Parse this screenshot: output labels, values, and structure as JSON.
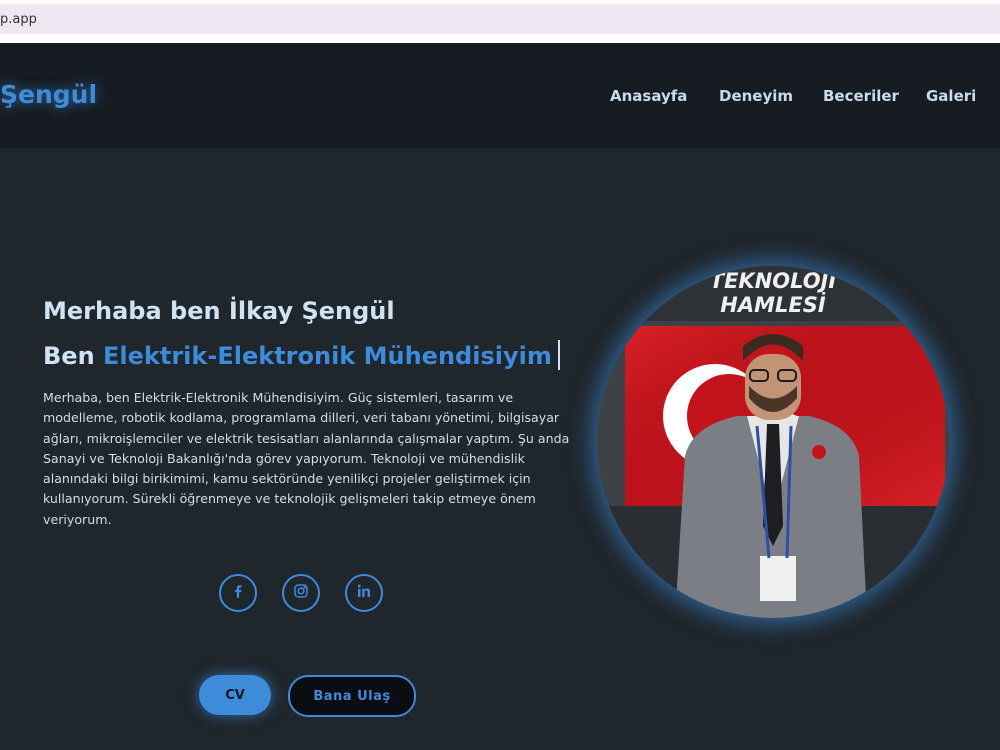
{
  "browser": {
    "url_text": "p.app"
  },
  "header": {
    "logo": "Şengül",
    "nav": [
      "Anasayfa",
      "Deneyim",
      "Beceriler",
      "Galeri"
    ]
  },
  "hero": {
    "greeting": "Merhaba ben İlkay Şengül",
    "role_prefix": "Ben",
    "role_highlight": "Elektrik-Elektronik Mühendisiyim",
    "description": "Merhaba, ben Elektrik-Elektronik Mühendisiyim. Güç sistemleri, tasarım ve modelleme, robotik kodlama, programlama dilleri, veri tabanı yönetimi, bilgisayar ağları, mikroişlemciler ve elektrik tesisatları alanlarında çalışmalar yaptım. Şu anda Sanayi ve Teknoloji Bakanlığı'nda görev yapıyorum. Teknoloji ve mühendislik alanındaki bilgi birikimimi, kamu sektöründe yenilikçi projeler geliştirmek için kullanıyorum. Sürekli öğrenmeye ve teknolojik gelişmeleri takip etmeye önem veriyorum.",
    "cv_button": "CV",
    "contact_button": "Bana Ulaş",
    "photo_sign_line1": "TEKNOLOJİ",
    "photo_sign_line2": "HAMLESİ"
  },
  "social": [
    "facebook-icon",
    "instagram-icon",
    "linkedin-icon"
  ],
  "colors": {
    "accent": "#3d8bd9",
    "background": "#1f262c",
    "navbar": "#161c21"
  }
}
